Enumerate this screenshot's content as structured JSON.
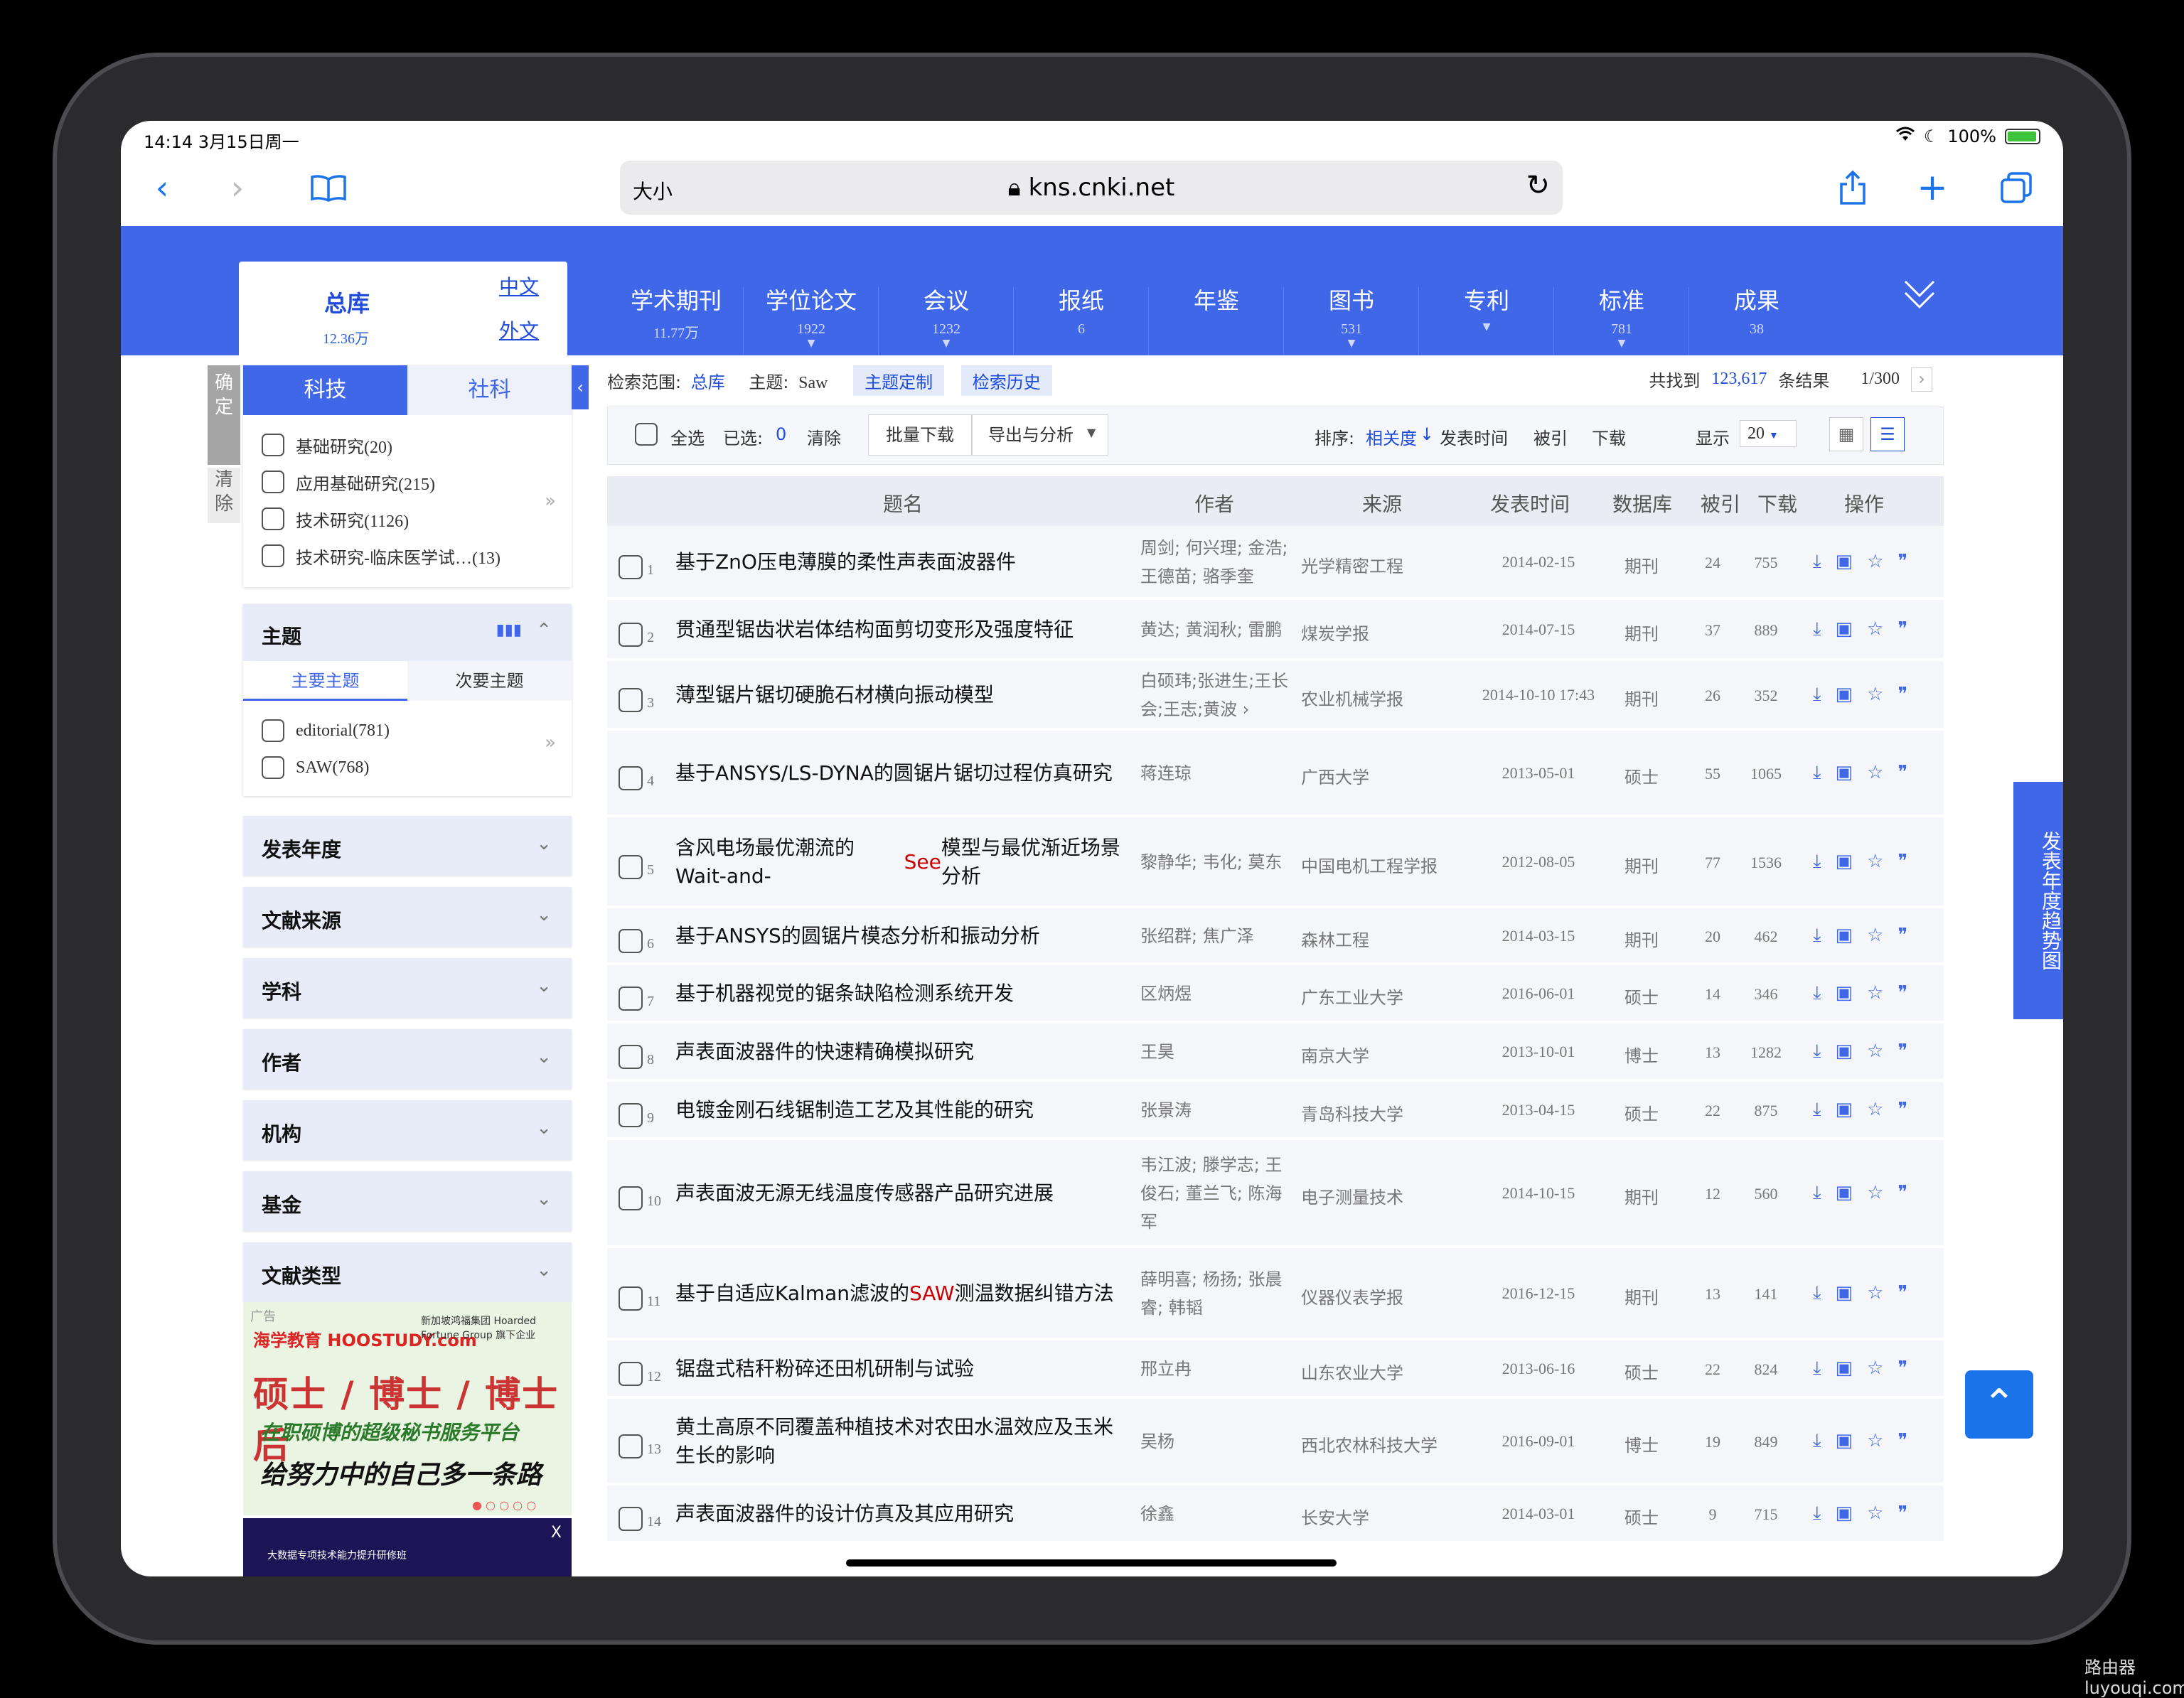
{
  "status": {
    "time": "14:14  3月15日周一",
    "battery": "100%"
  },
  "browser": {
    "aa": "大小",
    "url": "kns.cnki.net"
  },
  "home": {
    "title": "总库",
    "count": "12.36万",
    "zh": "中文",
    "wai": "外文"
  },
  "categories": [
    {
      "name": "学术期刊",
      "num": "11.77万",
      "tri": ""
    },
    {
      "name": "学位论文",
      "num": "1922",
      "tri": "▼"
    },
    {
      "name": "会议",
      "num": "1232",
      "tri": "▼"
    },
    {
      "name": "报纸",
      "num": "6",
      "tri": ""
    },
    {
      "name": "年鉴",
      "num": "",
      "tri": ""
    },
    {
      "name": "图书",
      "num": "531",
      "tri": "▼"
    },
    {
      "name": "专利",
      "num": "",
      "tri": "▼"
    },
    {
      "name": "标准",
      "num": "781",
      "tri": "▼"
    },
    {
      "name": "成果",
      "num": "38",
      "tri": ""
    }
  ],
  "sidebar": {
    "confirm": "确定",
    "clear": "清除",
    "tab_sci": "科技",
    "tab_soc": "社科",
    "levels": [
      "基础研究(20)",
      "应用基础研究(215)",
      "技术研究(1126)",
      "技术研究-临床医学试…(13)"
    ],
    "topic_title": "主题",
    "topic_main": "主要主题",
    "topic_sub": "次要主题",
    "topics": [
      "editorial(781)",
      "SAW(768)"
    ],
    "facets": [
      "发表年度",
      "文献来源",
      "学科",
      "作者",
      "机构",
      "基金",
      "文献类型"
    ],
    "ad_tag": "广告",
    "ad_brand": "海学教育 HOOSTUDY.com",
    "ad_brand2": "新加坡鸿福集团 Hoarded Fortune Group 旗下企业",
    "ad_big": "硕士 / 博士 / 博士后",
    "ad_sub": "在职硕博的超级秘书服务平台",
    "ad_slogan": "给努力中的自己多一条路",
    "ad2_text": "大数据专项技术能力提升研修班",
    "ad2_close": "X"
  },
  "scope": {
    "label": "检索范围:",
    "value": "总库",
    "topic_label": "主题:",
    "topic_value": "Saw",
    "btn1": "主题定制",
    "btn2": "检索历史",
    "found_prefix": "共找到",
    "found": "123,617",
    "found_suffix": "条结果",
    "page": "1/300"
  },
  "toolbar": {
    "select_all": "全选",
    "selected_label": "已选:",
    "selected": "0",
    "clear": "清除",
    "batch": "批量下载",
    "export": "导出与分析",
    "sort_label": "排序:",
    "sort_rel": "相关度",
    "sort_time": "发表时间",
    "sort_cite": "被引",
    "sort_dl": "下载",
    "show_label": "显示",
    "show": "20"
  },
  "headers": {
    "title": "题名",
    "author": "作者",
    "source": "来源",
    "date": "发表时间",
    "db": "数据库",
    "cite": "被引",
    "dl": "下载",
    "ops": "操作"
  },
  "rows": [
    {
      "n": "1",
      "title": "基于ZnO压电薄膜的柔性声表面波器件",
      "author": "周剑; 何兴理; 金浩; 王德苗; 骆季奎",
      "source": "光学精密工程",
      "date": "2014-02-15",
      "db": "期刊",
      "cite": "24",
      "dl": "755"
    },
    {
      "n": "2",
      "title": "贯通型锯齿状岩体结构面剪切变形及强度特征",
      "author": "黄达; 黄润秋; 雷鹏",
      "source": "煤炭学报",
      "date": "2014-07-15",
      "db": "期刊",
      "cite": "37",
      "dl": "889"
    },
    {
      "n": "3",
      "title": "薄型锯片锯切硬脆石材横向振动模型",
      "author": "白硕玮;张进生;王长会;王志;黄波 ›",
      "source": "农业机械学报",
      "date": "2014-10-10 17:43",
      "db": "期刊",
      "cite": "26",
      "dl": "352"
    },
    {
      "n": "4",
      "title": "基于ANSYS/LS-DYNA的圆锯片锯切过程仿真研究",
      "author": "蒋连琼",
      "source": "广西大学",
      "date": "2013-05-01",
      "db": "硕士",
      "cite": "55",
      "dl": "1065"
    },
    {
      "n": "5",
      "title_a": "含风电场最优潮流的Wait-and-",
      "title_b": "See",
      "title_c": "模型与最优渐近场景分析",
      "author": "黎静华; 韦化; 莫东",
      "source": "中国电机工程学报",
      "date": "2012-08-05",
      "db": "期刊",
      "cite": "77",
      "dl": "1536"
    },
    {
      "n": "6",
      "title": "基于ANSYS的圆锯片模态分析和振动分析",
      "author": "张绍群; 焦广泽",
      "source": "森林工程",
      "date": "2014-03-15",
      "db": "期刊",
      "cite": "20",
      "dl": "462"
    },
    {
      "n": "7",
      "title": "基于机器视觉的锯条缺陷检测系统开发",
      "author": "区炳煜",
      "source": "广东工业大学",
      "date": "2016-06-01",
      "db": "硕士",
      "cite": "14",
      "dl": "346"
    },
    {
      "n": "8",
      "title": "声表面波器件的快速精确模拟研究",
      "author": "王昊",
      "source": "南京大学",
      "date": "2013-10-01",
      "db": "博士",
      "cite": "13",
      "dl": "1282"
    },
    {
      "n": "9",
      "title": "电镀金刚石线锯制造工艺及其性能的研究",
      "author": "张景涛",
      "source": "青岛科技大学",
      "date": "2013-04-15",
      "db": "硕士",
      "cite": "22",
      "dl": "875"
    },
    {
      "n": "10",
      "title": "声表面波无源无线温度传感器产品研究进展",
      "author": "韦江波; 滕学志; 王俊石; 董兰飞; 陈海军",
      "source": "电子测量技术",
      "date": "2014-10-15",
      "db": "期刊",
      "cite": "12",
      "dl": "560"
    },
    {
      "n": "11",
      "title_a": "基于自适应Kalman滤波的",
      "title_b": "SAW",
      "title_c": "测温数据纠错方法",
      "author": "薛明喜; 杨扬; 张晨睿; 韩韬",
      "source": "仪器仪表学报",
      "date": "2016-12-15",
      "db": "期刊",
      "cite": "13",
      "dl": "141"
    },
    {
      "n": "12",
      "title": "锯盘式秸秆粉碎还田机研制与试验",
      "author": "邢立冉",
      "source": "山东农业大学",
      "date": "2013-06-16",
      "db": "硕士",
      "cite": "22",
      "dl": "824"
    },
    {
      "n": "13",
      "title": "黄土高原不同覆盖种植技术对农田水温效应及玉米生长的影响",
      "author": "吴杨",
      "source": "西北农林科技大学",
      "date": "2016-09-01",
      "db": "博士",
      "cite": "19",
      "dl": "849"
    },
    {
      "n": "14",
      "title": "声表面波器件的设计仿真及其应用研究",
      "author": "徐鑫",
      "source": "长安大学",
      "date": "2014-03-01",
      "db": "硕士",
      "cite": "9",
      "dl": "715"
    }
  ],
  "trend": "发表年度趋势图",
  "watermark": "路由器 luyouqi.com"
}
